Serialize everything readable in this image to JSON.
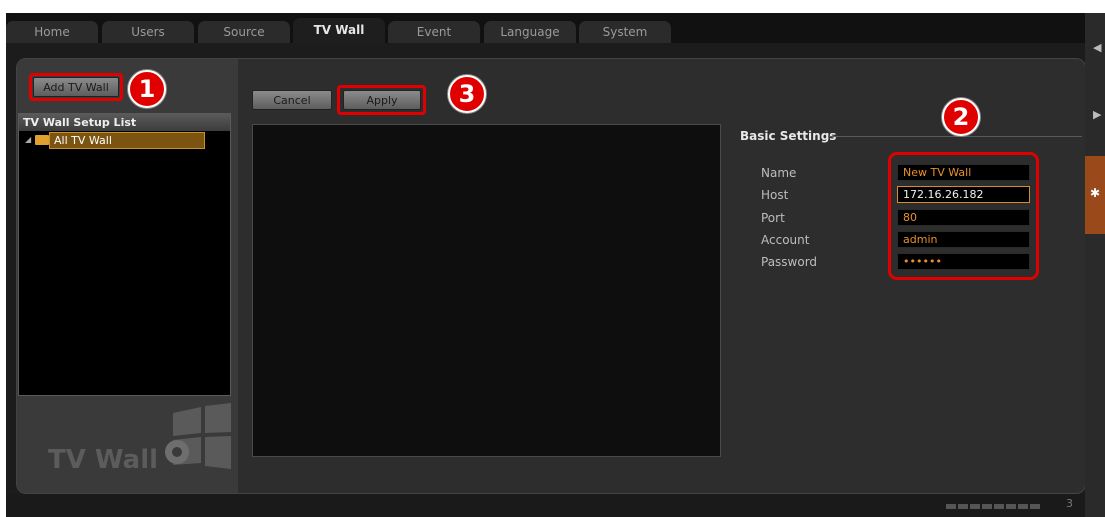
{
  "tabs": [
    {
      "label": "Home",
      "active": false
    },
    {
      "label": "Users",
      "active": false
    },
    {
      "label": "Source",
      "active": false
    },
    {
      "label": "TV Wall",
      "active": true
    },
    {
      "label": "Event",
      "active": false
    },
    {
      "label": "Language",
      "active": false
    },
    {
      "label": "System",
      "active": false
    }
  ],
  "toolbar": {
    "add_tv_wall_label": "Add TV Wall",
    "cancel_label": "Cancel",
    "apply_label": "Apply"
  },
  "tree": {
    "header": "TV Wall Setup List",
    "items": [
      {
        "label": "All TV Wall",
        "selected": true
      }
    ]
  },
  "logo": {
    "text": "TV Wall"
  },
  "basic_settings": {
    "title": "Basic Settings",
    "fields": [
      {
        "label": "Name",
        "value": "New TV Wall"
      },
      {
        "label": "Host",
        "value": "172.16.26.182"
      },
      {
        "label": "Port",
        "value": "80"
      },
      {
        "label": "Account",
        "value": "admin"
      },
      {
        "label": "Password",
        "value": "••••••"
      }
    ]
  },
  "annotations": {
    "step1": "1",
    "step2": "2",
    "step3": "3"
  },
  "status": {
    "count": "3"
  },
  "colors": {
    "highlight": "#e00000",
    "accent": "#e8902e",
    "selection": "#7a5410"
  }
}
